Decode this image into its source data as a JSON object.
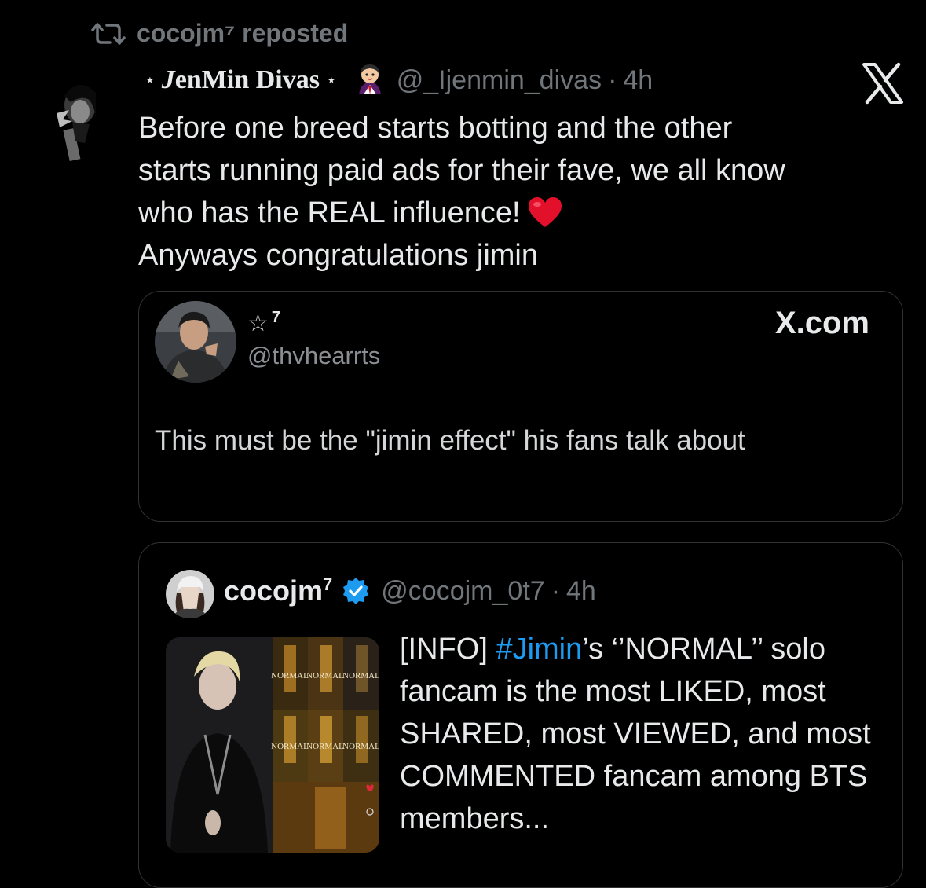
{
  "repost": {
    "label": "cocojm⁷ reposted"
  },
  "tweet": {
    "display_name_prefix": "⋆",
    "display_name_cursive": "J",
    "display_name_rest": "enMin Divas",
    "display_name_suffix": "⋆",
    "handle": "@_Ijenmin_divas",
    "separator": "·",
    "time": "4h",
    "lines": [
      "Before one breed starts botting and the other",
      "starts running paid ads for their fave, we all know",
      "who has the REAL influence!",
      "Anyways congratulations jimin"
    ]
  },
  "card1": {
    "star": "☆",
    "star_sup": "7",
    "handle": "@thvhearrts",
    "site": "X.com",
    "quote": "This must be the \"jimin effect\" his fans talk about"
  },
  "card2": {
    "name": "cocojm",
    "name_sup": "7",
    "handle": "@cocojm_0t7",
    "separator": "·",
    "time": "4h",
    "text_pre": "[INFO] ",
    "hashtag": "#Jimin",
    "text_post": "’s ‘’NORMAL’’ solo fancam is the most LIKED, most SHARED, most VIEWED, and most COMMENTED fancam among BTS members...",
    "thumbnail_labels": [
      "NORMAL",
      "NORMAL",
      "NORMAL",
      "NORMAL",
      "NORMAL",
      "NORMAL"
    ]
  },
  "icons": {
    "repost": "repost-icon",
    "x_logo": "x-logo-icon",
    "verified": "verified-badge-icon",
    "heart": "red-heart-emoji-icon"
  },
  "colors": {
    "background": "#000000",
    "text": "#e7e9ea",
    "muted": "#71767b",
    "accent": "#1d9bf0"
  }
}
